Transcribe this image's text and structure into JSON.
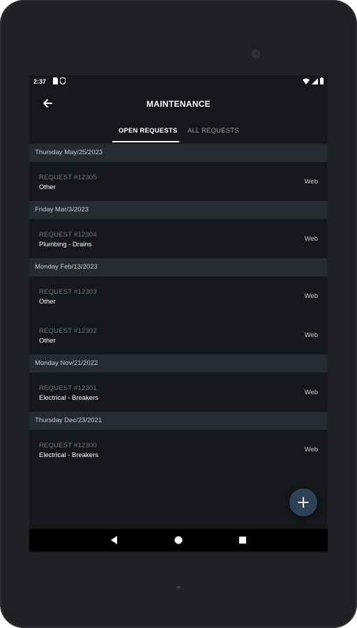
{
  "status_bar": {
    "time": "2:37",
    "icons_left": [
      "sim-card-icon",
      "shield-icon"
    ],
    "icons_right": [
      "wifi-icon",
      "signal-icon",
      "battery-icon"
    ]
  },
  "app_bar": {
    "title": "MAINTENANCE",
    "back_icon": "arrow-back-icon"
  },
  "tabs": [
    {
      "label": "OPEN REQUESTS",
      "active": true
    },
    {
      "label": "ALL REQUESTS",
      "active": false
    }
  ],
  "groups": [
    {
      "date": "Thursday May/25/2023",
      "requests": [
        {
          "number": "REQUEST #12305",
          "category": "Other",
          "source": "Web"
        }
      ]
    },
    {
      "date": "Friday Mar/3/2023",
      "requests": [
        {
          "number": "REQUEST #12304",
          "category": "Plumbing - Drains",
          "source": "Web"
        }
      ]
    },
    {
      "date": "Monday Feb/13/2023",
      "requests": [
        {
          "number": "REQUEST #12303",
          "category": "Other",
          "source": "Web"
        },
        {
          "number": "REQUEST #12302",
          "category": "Other",
          "source": "Web"
        }
      ]
    },
    {
      "date": "Monday Nov/21/2022",
      "requests": [
        {
          "number": "REQUEST #12301",
          "category": "Electrical - Breakers",
          "source": "Web"
        }
      ]
    },
    {
      "date": "Thursday Dec/23/2021",
      "requests": [
        {
          "number": "REQUEST #12300",
          "category": "Electrical - Breakers",
          "source": "Web"
        }
      ]
    }
  ],
  "fab": {
    "icon": "plus-icon"
  },
  "nav_bar": {
    "icons": [
      "nav-back-icon",
      "nav-home-icon",
      "nav-recents-icon"
    ]
  },
  "colors": {
    "background": "#15171b",
    "header_band": "#262a31",
    "fab": "#2e4257",
    "muted_text": "#6f7680"
  }
}
